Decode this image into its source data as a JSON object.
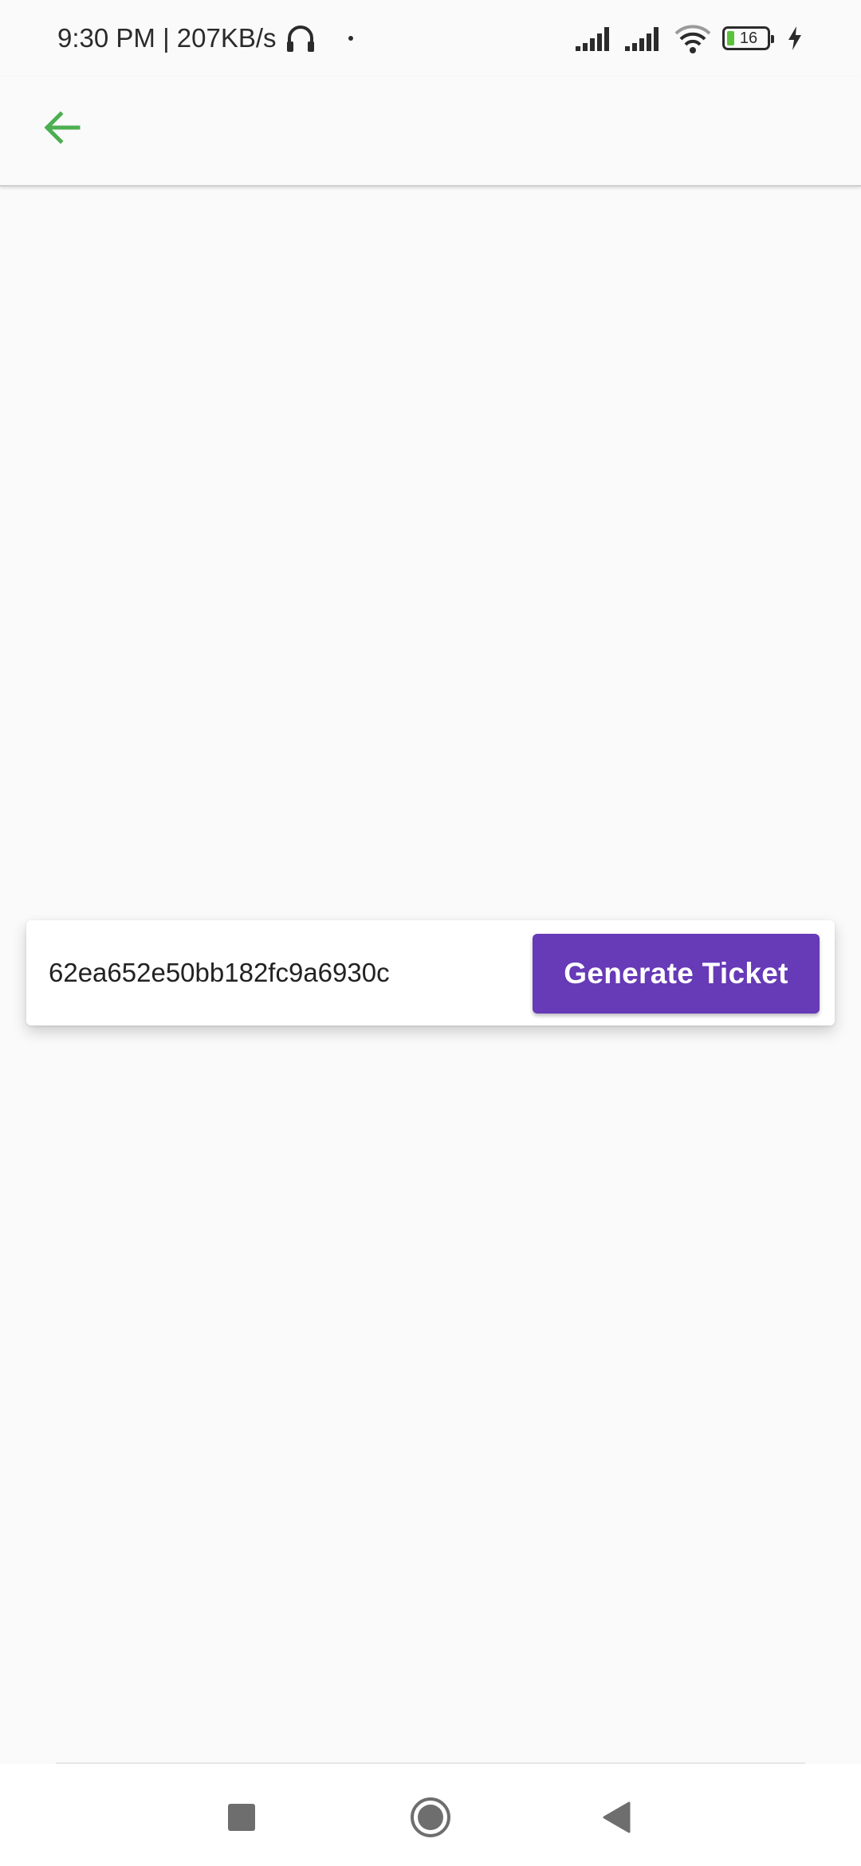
{
  "status_bar": {
    "time_speed": "9:30 PM | 207KB/s",
    "battery_level": "16",
    "icons": [
      "headphones-icon",
      "signal-icon",
      "signal-icon",
      "wifi-icon",
      "battery-icon",
      "charging-bolt-icon"
    ]
  },
  "app_bar": {
    "back_icon": "arrow-back-icon",
    "accent_color": "#4caf50"
  },
  "ticket_form": {
    "input_value": "62ea652e50bb182fc9a6930c",
    "button_label": "Generate Ticket",
    "button_color": "#673ab7"
  },
  "nav_bar": {
    "icons": [
      "recent-apps-icon",
      "home-icon",
      "back-icon"
    ]
  }
}
